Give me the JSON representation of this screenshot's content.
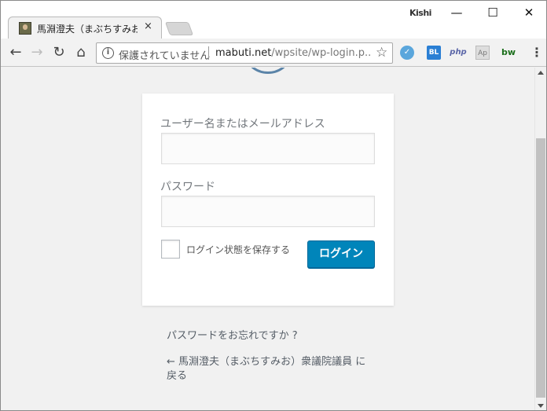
{
  "browser": {
    "tab_title": "馬淵澄夫（まぶちすみお）",
    "tab_close": "×",
    "profile_name": "Kishi",
    "window_controls": {
      "minimize": "—",
      "maximize": "☐",
      "close": "✕"
    },
    "nav": {
      "back": "←",
      "forward": "→",
      "reload": "↻",
      "home": "⌂"
    },
    "security_icon": "i",
    "security_label": "保護されていません",
    "url_host": "mabuti.net",
    "url_path": "/wpsite/wp-login.p...",
    "bookmark_star": "☆",
    "extensions": [
      {
        "name": "vivaldi-like-icon",
        "label": ""
      },
      {
        "name": "bl-extension-icon",
        "label": "BL"
      },
      {
        "name": "php-extension-icon",
        "label": "php"
      },
      {
        "name": "ap-extension-icon",
        "label": "Ap"
      },
      {
        "name": "bw-extension-icon",
        "label": "bw"
      }
    ],
    "menu_icon": "⋮"
  },
  "login": {
    "username_label": "ユーザー名またはメールアドレス",
    "username_value": "",
    "password_label": "パスワード",
    "password_value": "",
    "remember_label": "ログイン状態を保存する",
    "submit_label": "ログイン"
  },
  "links": {
    "lost_password": "パスワードをお忘れですか ?",
    "back_to_site": "← 馬淵澄夫（まぶちすみお）衆議院議員 に戻る"
  },
  "colors": {
    "primary_button": "#0085ba",
    "page_background": "#f1f1f1"
  }
}
